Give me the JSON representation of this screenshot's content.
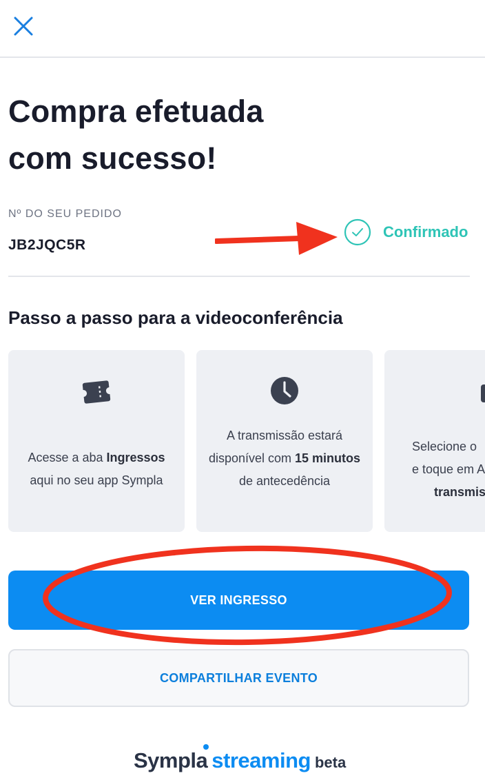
{
  "header": {
    "close_icon": "close-icon"
  },
  "title_line1": "Compra efetuada",
  "title_line2": "com sucesso!",
  "order": {
    "label": "Nº DO SEU PEDIDO",
    "code": "JB2JQC5R",
    "status": "Confirmado",
    "status_color": "#2ec4b6"
  },
  "steps": {
    "title": "Passo a passo para a videoconferência",
    "cards": [
      {
        "icon": "ticket-icon",
        "parts": [
          "Acesse a aba ",
          "Ingressos",
          " aqui no seu app Sympla"
        ]
      },
      {
        "icon": "clock-icon",
        "parts": [
          "A transmissão estará disponível com ",
          "15 minutos",
          " de antecedência"
        ]
      },
      {
        "icon": "video-icon",
        "parts": [
          "Selecione o",
          "e toque em A",
          "transmis"
        ]
      }
    ]
  },
  "buttons": {
    "primary": "VER INGRESSO",
    "secondary": "COMPARTILHAR EVENTO"
  },
  "brand": {
    "name": "Sympla",
    "product": "streaming",
    "tag": "beta"
  },
  "colors": {
    "accent": "#0c8cf2",
    "annotation": "#f0321e"
  }
}
